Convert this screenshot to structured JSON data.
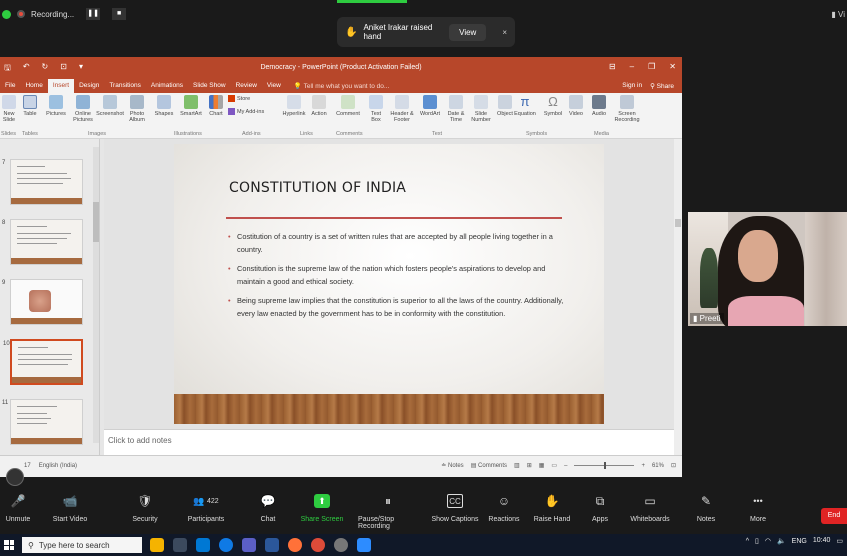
{
  "zoom_top": {
    "recording_label": "Recording...",
    "raise_hand_text": "Aniket Irakar raised hand",
    "view_button": "View",
    "close": "×",
    "view_options": "Vi"
  },
  "ppt": {
    "title": "Democracy - PowerPoint (Product Activation Failed)",
    "tabs": [
      "File",
      "Home",
      "Insert",
      "Design",
      "Transitions",
      "Animations",
      "Slide Show",
      "Review",
      "View"
    ],
    "active_tab": "Insert",
    "tell_me": "Tell me what you want to do...",
    "sign_in": "Sign in",
    "share": "Share",
    "ribbon": {
      "slides": [
        "New Slide"
      ],
      "tables": [
        "Table"
      ],
      "images": [
        "Pictures",
        "Online Pictures",
        "Screenshot",
        "Photo Album"
      ],
      "illustrations": [
        "Shapes",
        "SmartArt",
        "Chart"
      ],
      "addins": [
        "Store",
        "My Add-ins"
      ],
      "links": [
        "Hyperlink",
        "Action"
      ],
      "comments": [
        "Comment"
      ],
      "text": [
        "Text Box",
        "Header & Footer",
        "WordArt",
        "Date & Time",
        "Slide Number",
        "Object"
      ],
      "symbols": [
        "Equation",
        "Symbol"
      ],
      "media": [
        "Video",
        "Audio",
        "Screen Recording"
      ],
      "group_labels": [
        "Slides",
        "Tables",
        "Images",
        "Illustrations",
        "Add-ins",
        "Links",
        "Comments",
        "Text",
        "Symbols",
        "Media"
      ]
    },
    "thumb_numbers": [
      "7",
      "8",
      "9",
      "10",
      "11"
    ],
    "slide": {
      "title": "CONSTITUTION OF INDIA",
      "bullets": [
        "Costitution of a country is a set of written rules that are accepted by all people living together in a country.",
        "Constitution is the supreme law of the nation which fosters people's aspirations to develop and maintain a good and ethical society.",
        "Being supreme law implies that the constitution is superior to all the laws of the country. Additionally, every law enacted by the government has to be in conformity with the constitution."
      ]
    },
    "notes_placeholder": "Click to add notes",
    "status": {
      "slide_of": "17",
      "language": "English (India)",
      "notes": "Notes",
      "comments": "Comments",
      "zoom": "61%"
    }
  },
  "video": {
    "name": "Preeti"
  },
  "zoom_toolbar": {
    "buttons": [
      {
        "label": "Unmute",
        "icon": "microphone-muted-icon",
        "glyph": "🎤"
      },
      {
        "label": "Start Video",
        "icon": "video-off-icon",
        "glyph": "📹"
      },
      {
        "label": "Security",
        "icon": "shield-icon",
        "glyph": "🛡"
      },
      {
        "label": "Participants",
        "icon": "participants-icon",
        "glyph": "👥"
      },
      {
        "label": "Chat",
        "icon": "chat-icon",
        "glyph": "💬"
      },
      {
        "label": "Share Screen",
        "icon": "share-screen-icon",
        "glyph": "⬆"
      },
      {
        "label": "Pause/Stop Recording",
        "icon": "pause-recording-icon",
        "glyph": "⏸"
      },
      {
        "label": "Show Captions",
        "icon": "captions-icon",
        "glyph": "CC"
      },
      {
        "label": "Reactions",
        "icon": "reactions-icon",
        "glyph": "☺"
      },
      {
        "label": "Raise Hand",
        "icon": "raise-hand-icon",
        "glyph": "✋"
      },
      {
        "label": "Apps",
        "icon": "apps-icon",
        "glyph": "⧉"
      },
      {
        "label": "Whiteboards",
        "icon": "whiteboard-icon",
        "glyph": "▭"
      },
      {
        "label": "Notes",
        "icon": "notes-icon",
        "glyph": "✎"
      },
      {
        "label": "More",
        "icon": "more-icon",
        "glyph": "•••"
      }
    ],
    "participant_count": "422",
    "end": "End",
    "colors": {
      "share_green": "#2ecc40",
      "end_red": "#e02424",
      "ppt_accent": "#b7472a"
    }
  },
  "taskbar": {
    "search_placeholder": "Type here to search",
    "language": "ENG",
    "time": "10:40"
  }
}
